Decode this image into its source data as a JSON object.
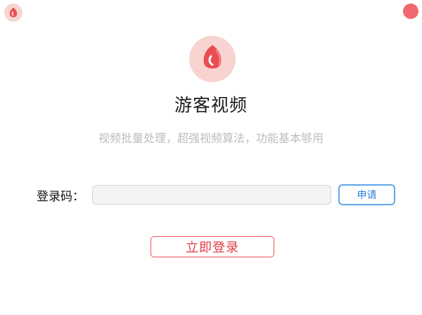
{
  "window": {
    "close_icon": "close-icon"
  },
  "colors": {
    "accent": "#f0696f",
    "brand": "#e94d52",
    "link_blue": "#2f7fd6"
  },
  "app": {
    "logo_icon": "video-petal-logo-icon",
    "title": "游客视频",
    "subtitle": "视频批量处理，超强视频算法，功能基本够用"
  },
  "form": {
    "code_label": "登录码：",
    "code_value": "",
    "apply_label": "申请",
    "login_label": "立即登录"
  }
}
